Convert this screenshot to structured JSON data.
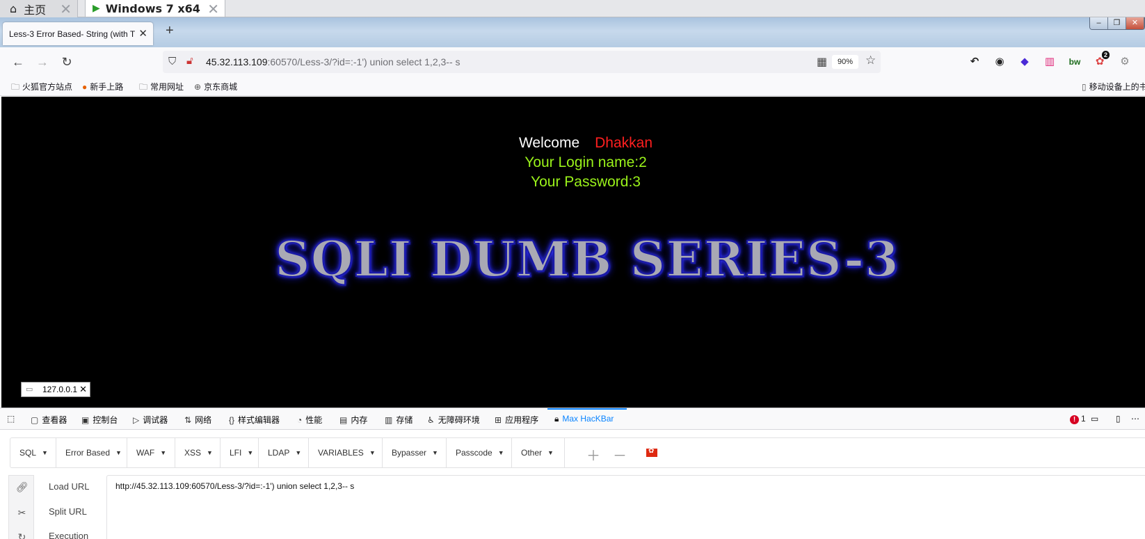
{
  "vm_tabs": [
    {
      "label": "主页"
    },
    {
      "label": "Windows 7 x64"
    }
  ],
  "browser": {
    "tab_title": "Less-3 Error Based- String (with T",
    "url_host": "45.32.113.109",
    "url_rest": ":60570/Less-3/?id=:-1') union select 1,2,3-- s",
    "zoom": "90%",
    "ext_badge": "2",
    "ext_bw": "bw"
  },
  "bookmarks": {
    "items": [
      {
        "label": "火狐官方站点"
      },
      {
        "label": "新手上路"
      },
      {
        "label": "常用网址"
      },
      {
        "label": "京东商城"
      }
    ],
    "mobile": "移动设备上的书签"
  },
  "page": {
    "welcome": "Welcome",
    "user": "Dhakkan",
    "login": "Your Login name:2",
    "password": "Your Password:3",
    "banner": "SQLI DUMB SERIES-3",
    "host_badge": "127.0.0.1"
  },
  "devtools": {
    "tabs": [
      {
        "label": "查看器"
      },
      {
        "label": "控制台"
      },
      {
        "label": "调试器"
      },
      {
        "label": "网络"
      },
      {
        "label": "样式编辑器"
      },
      {
        "label": "性能"
      },
      {
        "label": "内存"
      },
      {
        "label": "存储"
      },
      {
        "label": "无障碍环境"
      },
      {
        "label": "应用程序"
      },
      {
        "label": "Max HacKBar"
      }
    ],
    "error_count": "1"
  },
  "hackbar": {
    "menu": [
      {
        "label": "SQL"
      },
      {
        "label": "Error Based"
      },
      {
        "label": "WAF"
      },
      {
        "label": "XSS"
      },
      {
        "label": "LFI"
      },
      {
        "label": "LDAP"
      },
      {
        "label": "VARIABLES"
      },
      {
        "label": "Bypasser"
      },
      {
        "label": "Passcode"
      },
      {
        "label": "Other"
      }
    ],
    "actions": [
      {
        "label": "Load URL"
      },
      {
        "label": "Split URL"
      },
      {
        "label": "Execution"
      }
    ],
    "url_value": "http://45.32.113.109:60570/Less-3/?id=:-1') union select 1,2,3-- s"
  }
}
